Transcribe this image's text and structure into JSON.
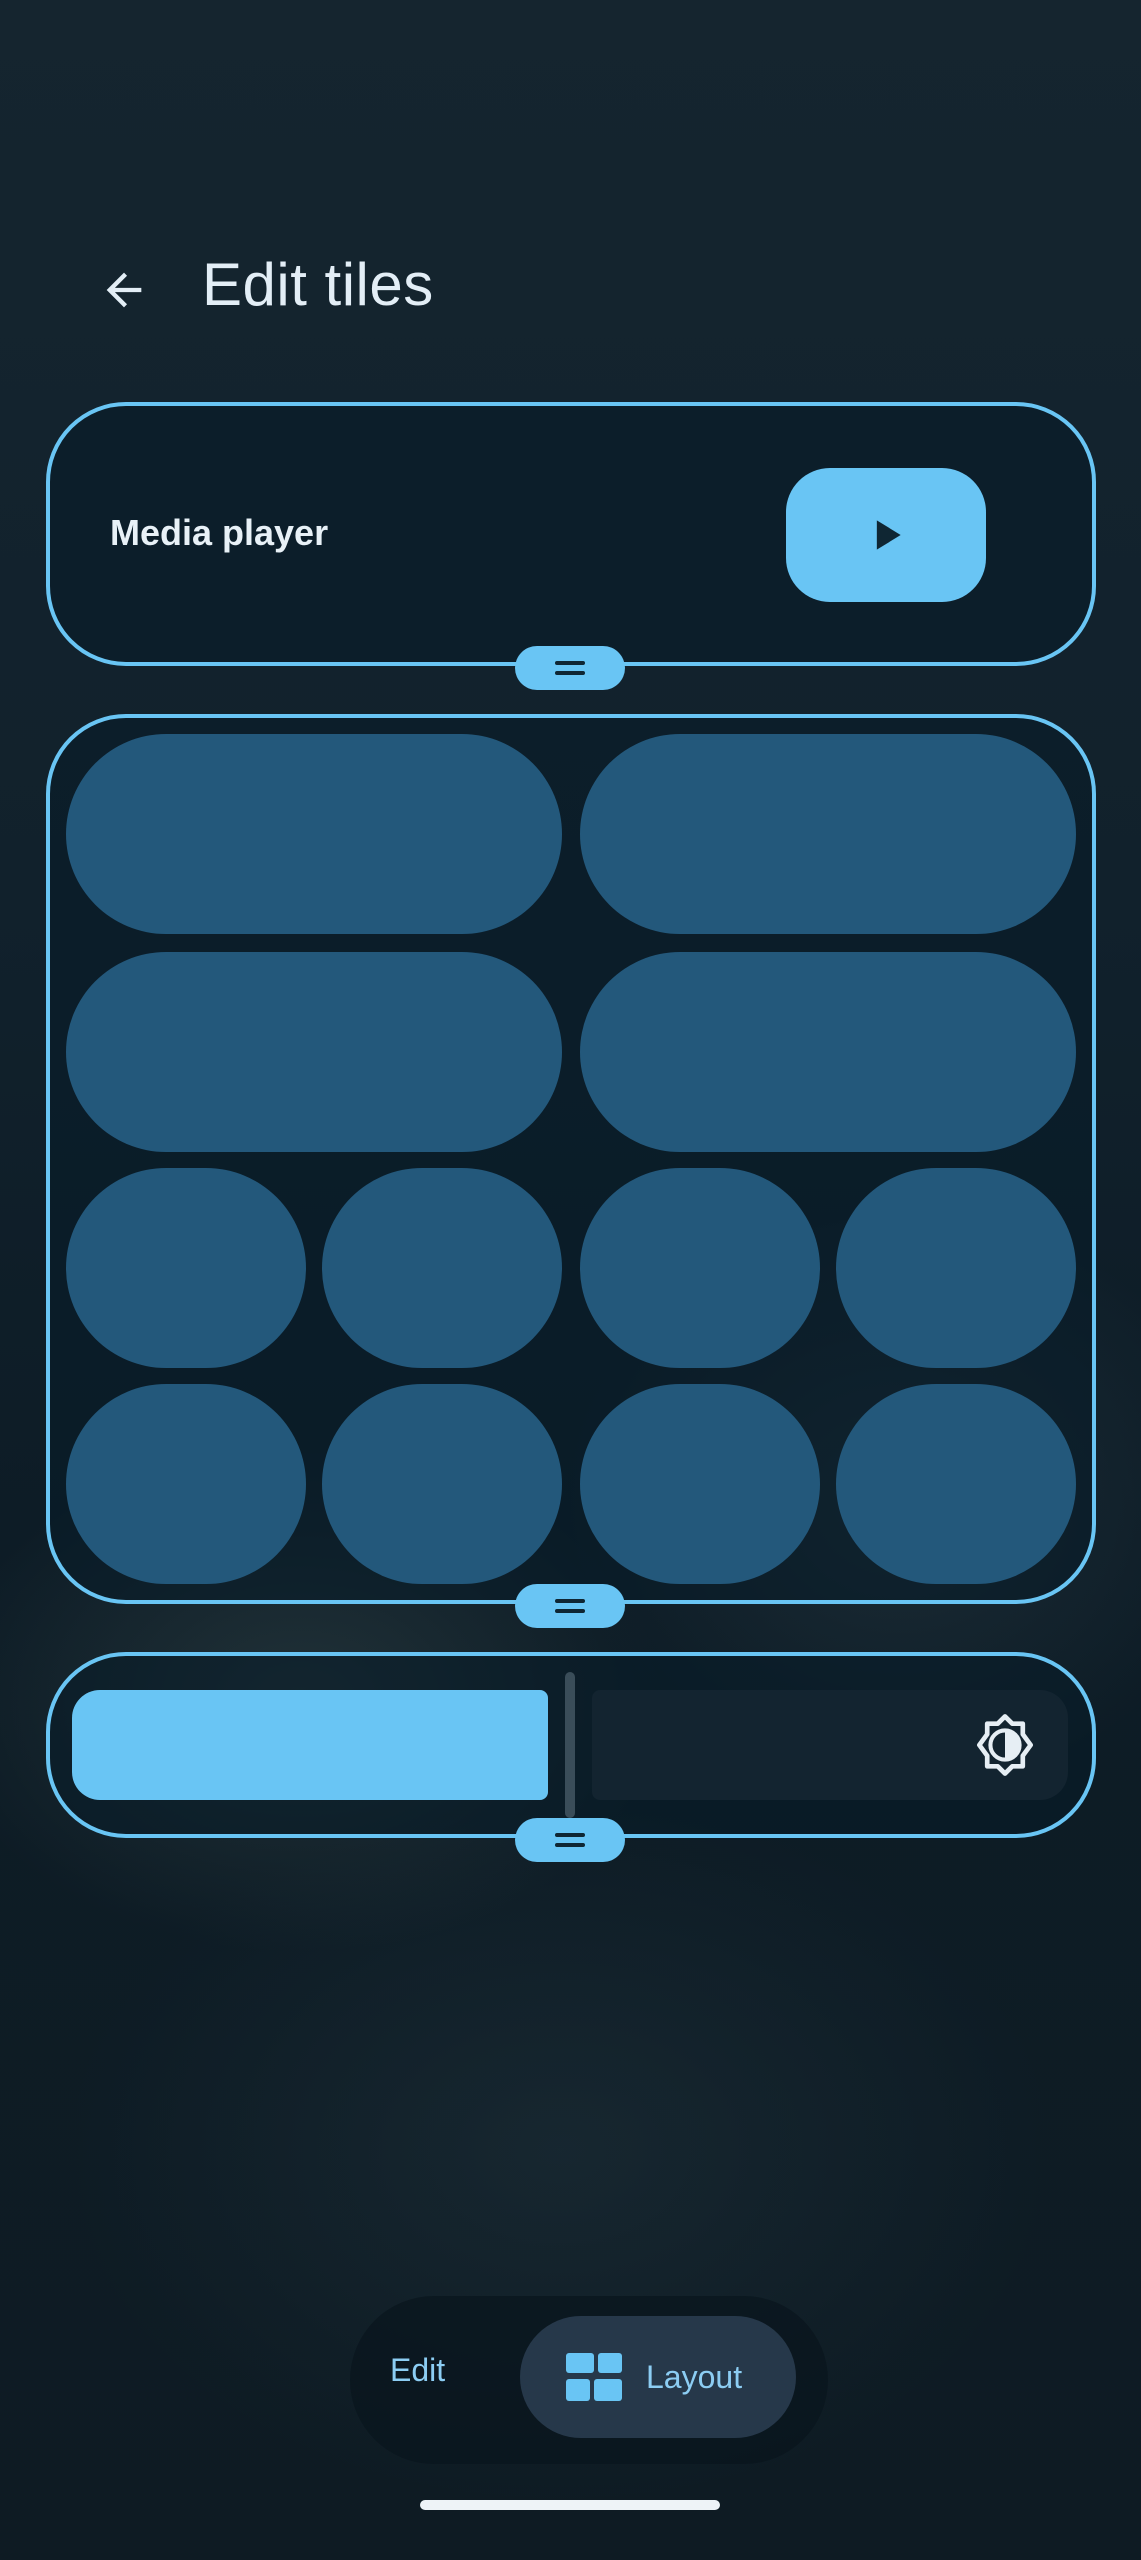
{
  "header": {
    "title": "Edit tiles",
    "back_icon": "arrow-left-icon"
  },
  "media": {
    "label": "Media player",
    "play_icon": "play-icon"
  },
  "tiles": {
    "wide_count": 4,
    "small_count": 8
  },
  "brightness": {
    "icon": "brightness-icon",
    "level": 0.5
  },
  "toolbar": {
    "edit_label": "Edit",
    "layout_label": "Layout",
    "layout_icon": "grid-icon",
    "selected": "Layout"
  },
  "colors": {
    "accent": "#69c5f4",
    "tile": "#23587b",
    "background": "#11212c"
  }
}
